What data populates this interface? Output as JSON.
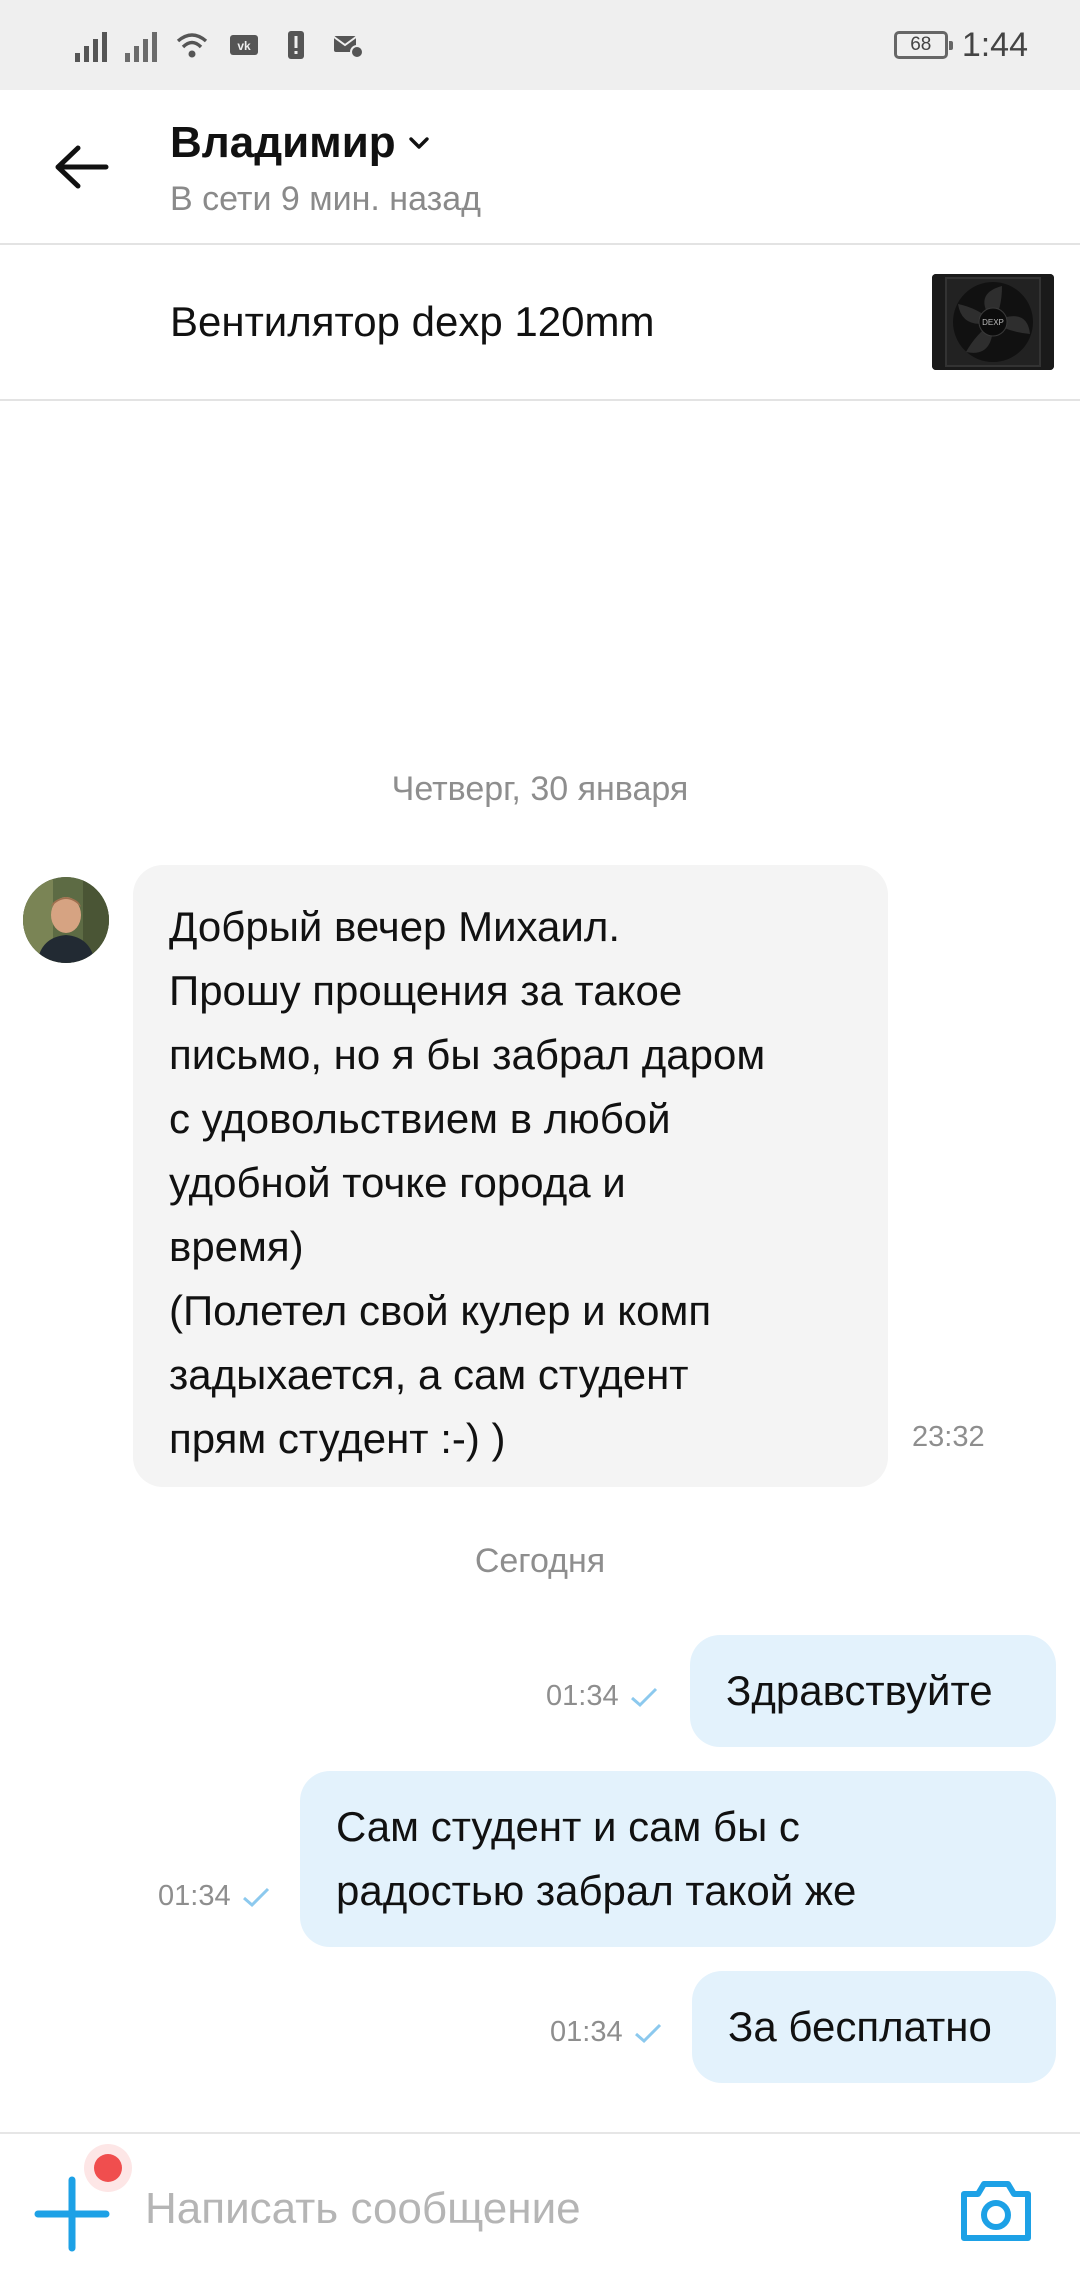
{
  "status_bar": {
    "battery": "68",
    "time": "1:44",
    "icons": [
      "signal-icon",
      "signal-icon",
      "wifi-icon",
      "vk-icon",
      "alert-icon",
      "mail-settings-icon"
    ]
  },
  "header": {
    "name": "Владимир",
    "status": "В сети 9 мин. назад",
    "icons": [
      "back-arrow-icon",
      "chevron-down-icon"
    ]
  },
  "item": {
    "title": "Вентилятор dexp 120mm",
    "thumb_label": "DEXP"
  },
  "messages": {
    "date1": "Четверг, 30 января",
    "incoming": {
      "lines": [
        "Добрый вечер Михаил.",
        "Прошу прощения за такое",
        "письмо, но я бы забрал даром",
        "с удовольствием в любой",
        "удобной точке города и",
        "время)",
        "(Полетел свой кулер и комп",
        "задыхается, а сам студент",
        "прям студент :-) )"
      ],
      "time": "23:32"
    },
    "date2": "Сегодня",
    "outgoing": [
      {
        "lines": [
          "Здравствуйте"
        ],
        "time": "01:34"
      },
      {
        "lines": [
          "Сам студент и сам бы с",
          "радостью забрал такой же"
        ],
        "time": "01:34"
      },
      {
        "lines": [
          "За бесплатно"
        ],
        "time": "01:34"
      }
    ]
  },
  "input": {
    "placeholder": "Написать сообщение",
    "icons": [
      "plus-icon",
      "camera-icon"
    ]
  },
  "colors": {
    "accent": "#1da1e6",
    "outgoing_bubble": "#e3f2fc",
    "incoming_bubble": "#f4f4f4",
    "notification_dot": "#f04e4e"
  }
}
